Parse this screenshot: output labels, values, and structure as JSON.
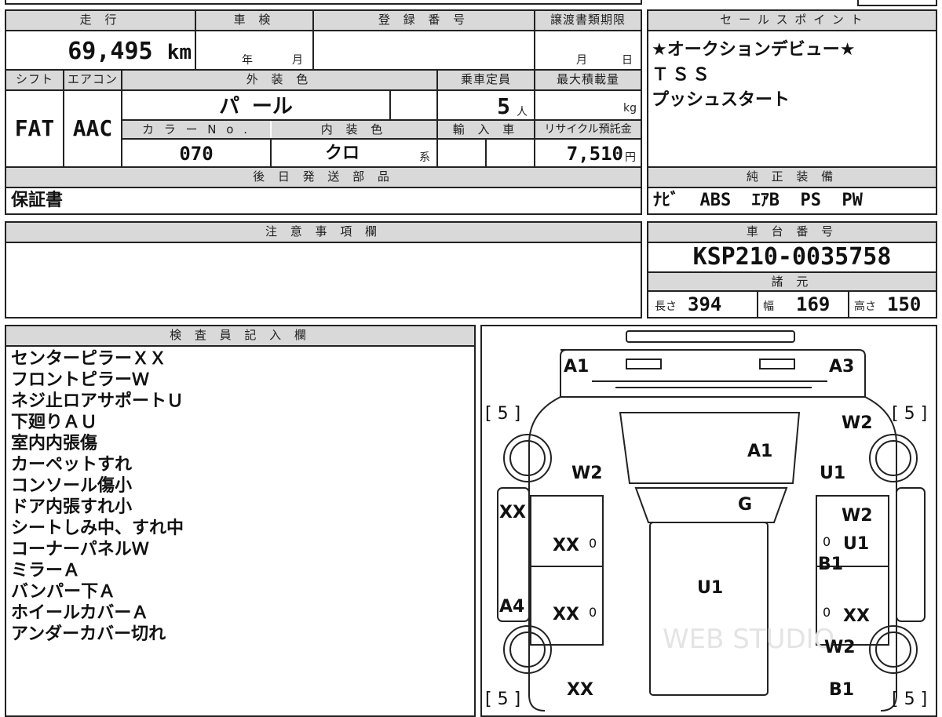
{
  "main_table": {
    "mileage_label": "走 行",
    "mileage_value": "69,495",
    "mileage_unit": "km",
    "shaken_label": "車 検",
    "year_unit": "年",
    "month_unit": "月",
    "registration_label": "登 録 番 号",
    "transfer_label": "譲渡書類期限",
    "transfer_month": "月",
    "transfer_day": "日",
    "shift_label": "シフト",
    "shift_value": "FAT",
    "ac_label": "エアコン",
    "ac_value": "AAC",
    "exterior_label": "外 装 色",
    "exterior_value": "パ ール",
    "capacity_label": "乗車定員",
    "capacity_value": "5",
    "capacity_unit": "人",
    "max_load_label": "最大積載量",
    "max_load_unit": "kg",
    "color_no_label": "カ ラ ー N o .",
    "color_no_value": "070",
    "interior_label": "内 装 色",
    "interior_value": "クロ",
    "interior_suffix": "系",
    "import_label": "輸 入 車",
    "recycle_label": "リサイクル預託金",
    "recycle_value": "7,510",
    "recycle_unit": "円",
    "later_parts_label": "後 日 発 送 部 品",
    "later_parts_value": "保証書"
  },
  "sales_points": {
    "label": "セ ー ル ス ポ イ ン ト",
    "lines": [
      "★オークションデビュー★",
      "ＴＳＳ",
      "プッシュスタート"
    ]
  },
  "genuine_equipment": {
    "label": "純 正 装 備",
    "value": "ﾅﾋﾞ  ABS  ｴｱB  PS  PW"
  },
  "notes": {
    "label": "注 意 事 項 欄",
    "value": ""
  },
  "chassis": {
    "label": "車 台 番 号",
    "value": "KSP210-0035758"
  },
  "specs": {
    "label": "諸 元",
    "length_label": "長さ",
    "length_value": "394",
    "width_label": "幅",
    "width_value": "169",
    "height_label": "高さ",
    "height_value": "150"
  },
  "inspector": {
    "label": "検 査 員 記 入 欄",
    "lines": [
      "センターピラーＸＸ",
      "フロントピラーＷ",
      "ネジ止ロアサポートＵ",
      "下廻りＡＵ",
      "室内内張傷",
      "カーペットすれ",
      "コンソール傷小",
      "ドア内張すれ小",
      "シートしみ中、すれ中",
      "コーナーパネルＷ",
      "ミラーＡ",
      "バンパー下Ａ",
      "ホイールカバーＡ",
      "アンダーカバー切れ"
    ]
  },
  "car_diagram": {
    "marks": {
      "a1_front_left": "A1",
      "a3_front_right": "A3",
      "tire_fl": "[ 5 ]",
      "tire_fr": "[ 5 ]",
      "tire_rl": "[ 5 ]",
      "tire_rr": "[ 5 ]",
      "hood": "A1",
      "fender_left": "W2",
      "fender_right_w2": "W2",
      "fender_right_u1": "U1",
      "windshield": "G",
      "pillar_left": "XX",
      "door_fl": "XX",
      "door_rl": "XX",
      "sill_left": "A4",
      "roof": "U1",
      "door_fr_w2": "W2",
      "door_fr_u1": "U1",
      "door_fr_b1": "B1",
      "door_rr": "XX",
      "rear_fender_right": "W2",
      "rear_left": "XX",
      "rear_right": "B1",
      "zero_mark": "0"
    },
    "watermark": "WEB STUDIO"
  }
}
